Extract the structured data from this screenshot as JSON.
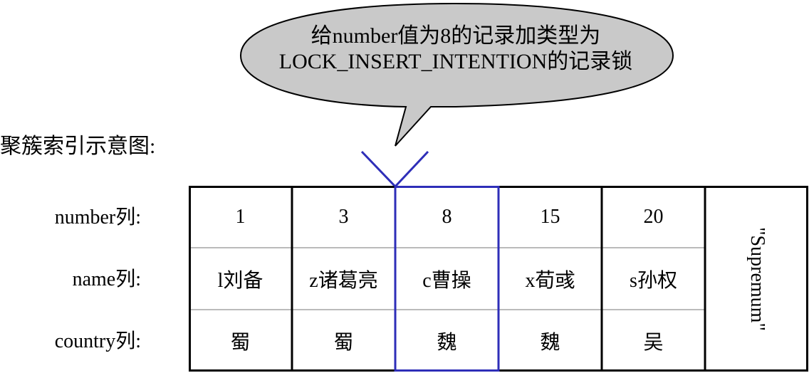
{
  "callout": {
    "line1": "给number值为8的记录加类型为",
    "line2": "LOCK_INSERT_INTENTION的记录锁"
  },
  "diagram_title": "聚簇索引示意图:",
  "row_labels": {
    "number": "number列:",
    "name": "name列:",
    "country": "country列:"
  },
  "records": [
    {
      "number": "1",
      "name": "l刘备",
      "country": "蜀"
    },
    {
      "number": "3",
      "name": "z诸葛亮",
      "country": "蜀"
    },
    {
      "number": "8",
      "name": "c曹操",
      "country": "魏"
    },
    {
      "number": "15",
      "name": "x荀彧",
      "country": "魏"
    },
    {
      "number": "20",
      "name": "s孙权",
      "country": "吴"
    }
  ],
  "supremum_label": "\"Supremum\"",
  "highlighted_record_number": "8",
  "colors": {
    "bubble_fill": "#c9c9c9",
    "highlight": "#2e2eb8",
    "grid_outer": "#000000",
    "grid_inner": "#bbbbbb"
  }
}
